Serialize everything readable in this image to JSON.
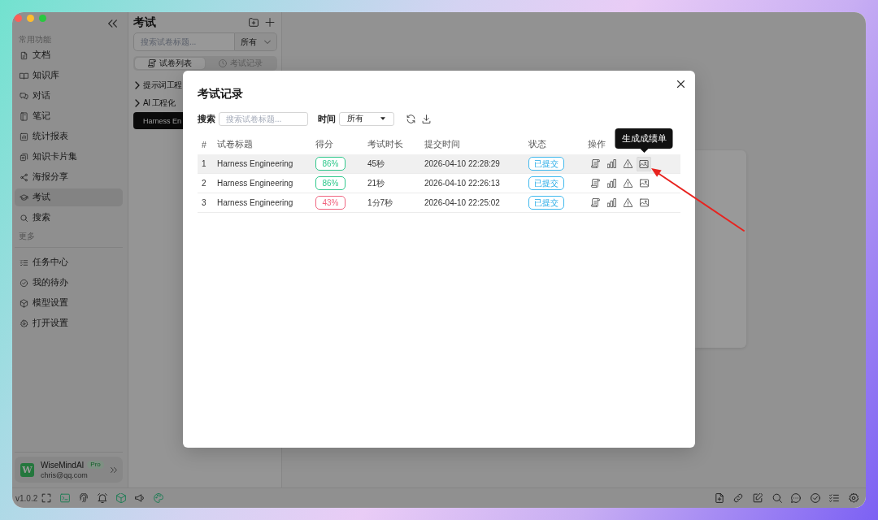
{
  "window": {
    "version": "v1.0.2"
  },
  "sidebar": {
    "sections": [
      {
        "label": "常用功能",
        "items": [
          {
            "label": "文档",
            "selected": false
          },
          {
            "label": "知识库",
            "selected": false
          },
          {
            "label": "对话",
            "selected": false
          },
          {
            "label": "笔记",
            "selected": false
          },
          {
            "label": "统计报表",
            "selected": false
          },
          {
            "label": "知识卡片集",
            "selected": false
          },
          {
            "label": "海报分享",
            "selected": false
          },
          {
            "label": "考试",
            "selected": true
          },
          {
            "label": "搜索",
            "selected": false
          }
        ]
      },
      {
        "label": "更多",
        "items": [
          {
            "label": "任务中心",
            "selected": false
          },
          {
            "label": "我的待办",
            "selected": false
          },
          {
            "label": "模型设置",
            "selected": false
          },
          {
            "label": "打开设置",
            "selected": false
          }
        ]
      }
    ],
    "user": {
      "logo": "W",
      "name": "WiseMindAI",
      "plan": "Pro",
      "email": "chris@qq.com"
    }
  },
  "exam_panel": {
    "title": "考试",
    "search": {
      "placeholder": "搜索试卷标题..."
    },
    "filter": "所有",
    "tabs": [
      {
        "label": "试卷列表",
        "selected": true
      },
      {
        "label": "考试记录",
        "selected": false
      }
    ],
    "tree": [
      {
        "kind": "folder",
        "label": "提示词工程",
        "expanded": false,
        "selected": false
      },
      {
        "kind": "folder",
        "label": "AI 工程化",
        "expanded": false,
        "selected": false
      },
      {
        "kind": "paper",
        "label": "Harness En",
        "selected": true
      }
    ]
  },
  "dialog": {
    "title": "考试记录",
    "search_label": "搜索",
    "search": {
      "placeholder": "搜索试卷标题..."
    },
    "time_label": "时间",
    "time_filter": "所有",
    "columns": [
      "#",
      "试卷标题",
      "得分",
      "考试时长",
      "提交时间",
      "状态",
      "操作"
    ],
    "rows": [
      {
        "index": "1",
        "title": "Harness Engineering",
        "score": {
          "text": "86%",
          "color": "#2fc88c"
        },
        "duration": "45秒",
        "submitted": "2026-04-10 22:28:29",
        "status": "已提交",
        "selected": true,
        "actions": [
          {
            "hovered": false
          },
          {
            "hovered": false
          },
          {
            "hovered": false
          },
          {
            "hovered": true,
            "tooltip": "生成成绩单"
          }
        ]
      },
      {
        "index": "2",
        "title": "Harness Engineering",
        "score": {
          "text": "86%",
          "color": "#2fc88c"
        },
        "duration": "21秒",
        "submitted": "2026-04-10 22:26:13",
        "status": "已提交",
        "selected": false,
        "actions": [
          {
            "hovered": false
          },
          {
            "hovered": false
          },
          {
            "hovered": false
          },
          {
            "hovered": false
          }
        ]
      },
      {
        "index": "3",
        "title": "Harness Engineering",
        "score": {
          "text": "43%",
          "color": "#f0647f"
        },
        "duration": "1分7秒",
        "submitted": "2026-04-10 22:25:02",
        "status": "已提交",
        "selected": false,
        "actions": [
          {
            "hovered": false
          },
          {
            "hovered": false
          },
          {
            "hovered": false
          },
          {
            "hovered": false
          }
        ]
      }
    ]
  }
}
